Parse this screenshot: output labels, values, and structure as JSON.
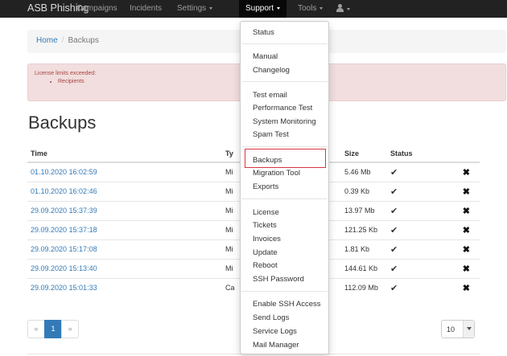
{
  "navbar": {
    "brand": "ASB Phishing",
    "items": [
      {
        "label": "Campaigns"
      },
      {
        "label": "Incidents"
      },
      {
        "label": "Settings"
      },
      {
        "label": "Support"
      },
      {
        "label": "Tools"
      }
    ]
  },
  "breadcrumb": {
    "home": "Home",
    "separator": "/",
    "current": "Backups"
  },
  "alert": {
    "message": "License limits exceeded:",
    "items": [
      "Recipients"
    ]
  },
  "page_title": "Backups",
  "table": {
    "headers": [
      "Time",
      "Ty",
      "Size",
      "Status"
    ],
    "rows": [
      {
        "time": "01.10.2020 16:02:59",
        "type": "Mi",
        "size": "5.46 Mb",
        "status": "✔"
      },
      {
        "time": "01.10.2020 16:02:46",
        "type": "Mi",
        "size": "0.39 Kb",
        "status": "✔"
      },
      {
        "time": "29.09.2020 15:37:39",
        "type": "Mi",
        "size": "13.97 Mb",
        "status": "✔"
      },
      {
        "time": "29.09.2020 15:37:18",
        "type": "Mi",
        "size": "121.25 Kb",
        "status": "✔"
      },
      {
        "time": "29.09.2020 15:17:08",
        "type": "Mi",
        "size": "1.81 Kb",
        "status": "✔"
      },
      {
        "time": "29.09.2020 15:13:40",
        "type": "Mi",
        "size": "144.61 Kb",
        "status": "✔"
      },
      {
        "time": "29.09.2020 15:01:33",
        "type": "Ca",
        "size": "112.09 Mb",
        "status": "✔"
      }
    ],
    "delete_glyph": "✖"
  },
  "pagination": {
    "prev": "«",
    "current": "1",
    "next": "»"
  },
  "page_size": "10",
  "support_menu": {
    "items": [
      "Status",
      "Manual",
      "Changelog",
      "Test email",
      "Performance Test",
      "System Monitoring",
      "Spam Test",
      "Backups",
      "Migration Tool",
      "Exports",
      "License",
      "Tickets",
      "Invoices",
      "Update",
      "Reboot",
      "SSH Password",
      "Enable SSH Access",
      "Send Logs",
      "Service Logs",
      "Mail Manager"
    ]
  },
  "colors": {
    "navbar": "#222222",
    "link": "#337ab7",
    "alert_bg": "#f2dede",
    "alert_text": "#a94442",
    "highlight": "#d9333f"
  }
}
